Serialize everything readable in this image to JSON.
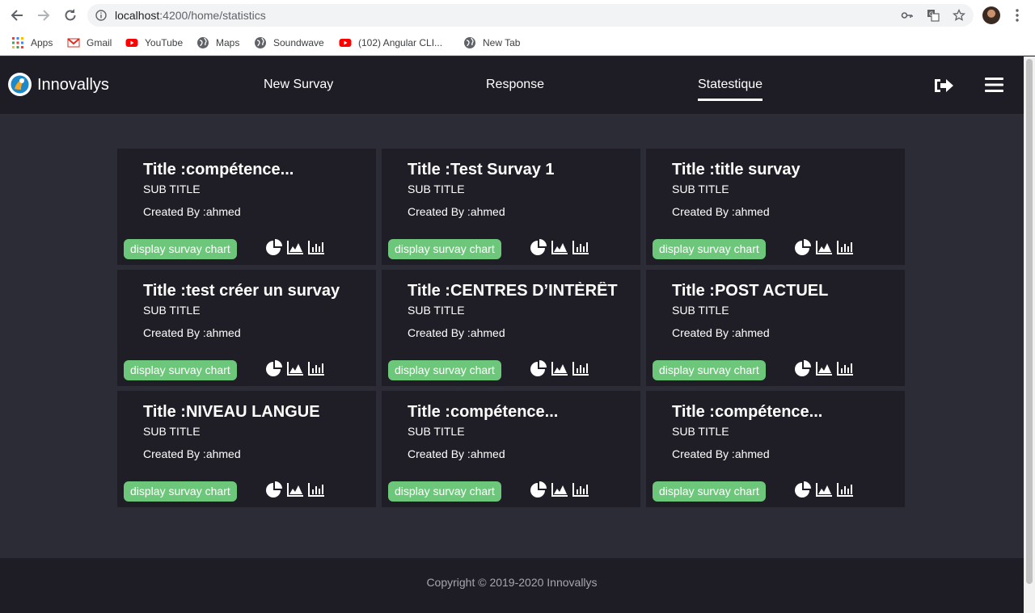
{
  "browser": {
    "url_host": "localhost",
    "url_path": ":4200/home/statistics",
    "bookmarks": [
      {
        "label": "Apps",
        "icon": "apps-grid-icon"
      },
      {
        "label": "Gmail",
        "icon": "gmail-icon"
      },
      {
        "label": "YouTube",
        "icon": "youtube-icon"
      },
      {
        "label": "Maps",
        "icon": "globe-icon"
      },
      {
        "label": "Soundwave",
        "icon": "globe-icon"
      },
      {
        "label": "(102) Angular CLI...",
        "icon": "youtube-icon"
      },
      {
        "label": "New Tab",
        "icon": "globe-icon"
      }
    ]
  },
  "header": {
    "brand": "Innovallys",
    "nav": [
      {
        "label": "New Survay",
        "active": false
      },
      {
        "label": "Response",
        "active": false
      },
      {
        "label": "Statestique",
        "active": true
      }
    ]
  },
  "cards": [
    {
      "title": "Title :compétence...",
      "subtitle": "SUB TITLE",
      "creator": "Created By :ahmed",
      "button": "display survay chart"
    },
    {
      "title": "Title :Test Survay 1",
      "subtitle": "SUB TITLE",
      "creator": "Created By :ahmed",
      "button": "display survay chart"
    },
    {
      "title": "Title :title survay",
      "subtitle": "SUB TITLE",
      "creator": "Created By :ahmed",
      "button": "display survay chart"
    },
    {
      "title": "Title :test créer un survay",
      "subtitle": "SUB TITLE",
      "creator": "Created By :ahmed",
      "button": "display survay chart"
    },
    {
      "title": "Title :CENTRES D’INTÈRÊT",
      "subtitle": "SUB TITLE",
      "creator": "Created By :ahmed",
      "button": "display survay chart"
    },
    {
      "title": "Title :POST ACTUEL",
      "subtitle": "SUB TITLE",
      "creator": "Created By :ahmed",
      "button": "display survay chart"
    },
    {
      "title": "Title :NIVEAU LANGUE",
      "subtitle": "SUB TITLE",
      "creator": "Created By :ahmed",
      "button": "display survay chart"
    },
    {
      "title": "Title :compétence...",
      "subtitle": "SUB TITLE",
      "creator": "Created By :ahmed",
      "button": "display survay chart"
    },
    {
      "title": "Title :compétence...",
      "subtitle": "SUB TITLE",
      "creator": "Created By :ahmed",
      "button": "display survay chart"
    }
  ],
  "footer": {
    "copyright": "Copyright © 2019-2020 Innovallys"
  },
  "colors": {
    "header_bg": "#1e1d25",
    "page_bg": "#2c2c37",
    "card_bg": "#1f1e26",
    "button_green": "#6dc77a"
  }
}
